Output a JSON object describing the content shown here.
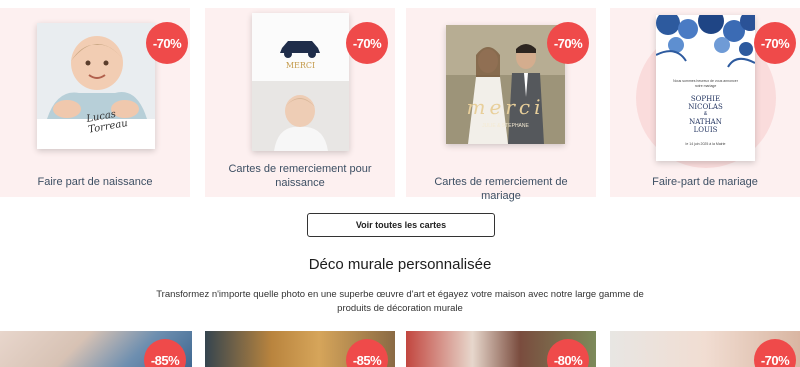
{
  "cards": [
    {
      "label": "Faire part de naissance",
      "discount": "-70%",
      "script_name": "Lucas Torreau"
    },
    {
      "label": "Cartes de remerciement pour naissance",
      "discount": "-70%",
      "merci": "MERCI"
    },
    {
      "label": "Cartes de remerciement de mariage",
      "discount": "-70%",
      "script_text": "merci",
      "subtext": "JULIE & STEPHANE"
    },
    {
      "label": "Faire-part de mariage",
      "discount": "-70%",
      "invite_top": "Nous sommes heureux de vous annoncer notre mariage",
      "name1": "SOPHIE",
      "name2": "NICOLAS",
      "amp": "&",
      "name3": "NATHAN",
      "name4": "LOUIS",
      "invite_bottom": "le 14 juin 2025 à la Mairie"
    }
  ],
  "see_all_button": "Voir toutes les cartes",
  "section": {
    "title": "Déco murale personnalisée",
    "description": "Transformez n'importe quelle photo en une superbe œuvre d'art et égayez votre maison avec notre large gamme de produits de décoration murale"
  },
  "photos": [
    {
      "discount": "-85%"
    },
    {
      "discount": "-85%"
    },
    {
      "discount": "-80%"
    },
    {
      "discount": "-70%"
    }
  ],
  "colors": {
    "badge": "#ef4a4a",
    "card_bg": "#fdf0f0",
    "label": "#3d4f63"
  }
}
